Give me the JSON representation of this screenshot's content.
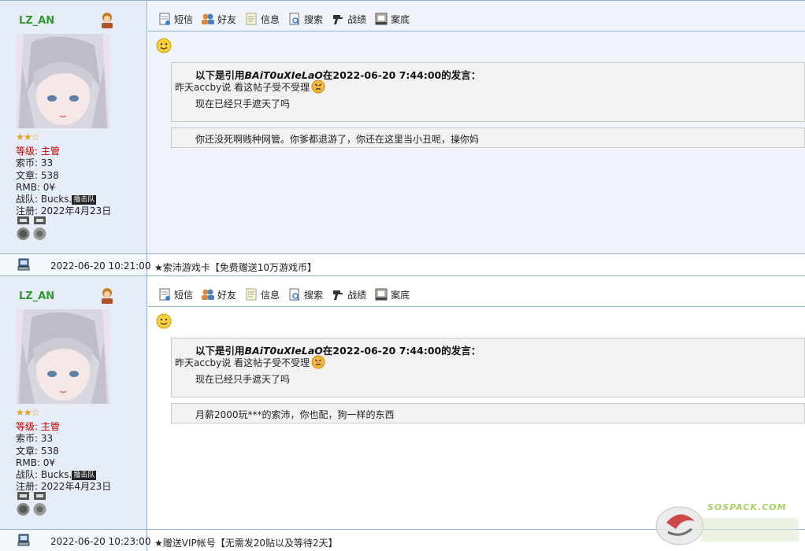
{
  "posts": [
    {
      "username": "LZ_AN",
      "stars": "★★☆",
      "level_label": "等级:",
      "level_value": "主管",
      "coins": "索币: 33",
      "articles": "文章: 538",
      "rmb": "RMB: 0¥",
      "team_prefix": "战队: Bucks.",
      "team_badge": "撸击队",
      "registered": "注册: 2022年4月23日",
      "toolbar": [
        "短信",
        "好友",
        "信息",
        "搜索",
        "战绩",
        "案底"
      ],
      "quote_header_prefix": "以下是引用",
      "quote_author": "BAiT0uXIeLaO",
      "quote_header_suffix": "在2022-06-20 7:44:00的发言：",
      "quote_line1": "昨天accby说 看这帖子受不受理",
      "quote_line2": "现在已经只手遮天了吗",
      "reply": "你还没死啊贱种网管。你爹都退游了，你还在这里当小丑呢，操你妈",
      "timestamp": "2022-06-20 10:21:00",
      "signature": "★索沛游戏卡【免费赠送10万游戏币】"
    },
    {
      "username": "LZ_AN",
      "stars": "★★☆",
      "level_label": "等级:",
      "level_value": "主管",
      "coins": "索币: 33",
      "articles": "文章: 538",
      "rmb": "RMB: 0¥",
      "team_prefix": "战队: Bucks.",
      "team_badge": "撸击队",
      "registered": "注册: 2022年4月23日",
      "toolbar": [
        "短信",
        "好友",
        "信息",
        "搜索",
        "战绩",
        "案底"
      ],
      "quote_header_prefix": "以下是引用",
      "quote_author": "BAiT0uXIeLaO",
      "quote_header_suffix": "在2022-06-20 7:44:00的发言：",
      "quote_line1": "昨天accby说 看这帖子受不受理",
      "quote_line2": "现在已经只手遮天了吗",
      "reply": "月薪2000玩***的索沛，你也配，狗一样的东西",
      "timestamp": "2022-06-20 10:23:00",
      "signature": "★赠送VIP帐号【无需发20贴以及等待2天】"
    }
  ],
  "watermark": "SOSPACK.COM",
  "icons": {
    "toolbar": [
      "message-icon",
      "friends-icon",
      "info-icon",
      "search-icon",
      "record-icon",
      "history-icon"
    ],
    "computer": "computer-icon",
    "smiley": "smiley-icon",
    "angry": "angry-face-icon"
  }
}
